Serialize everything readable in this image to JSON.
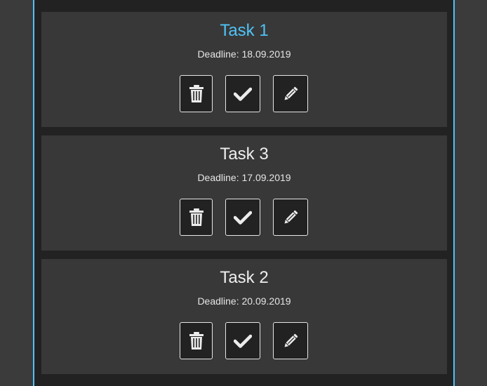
{
  "tasks": [
    {
      "title": "Task 1",
      "deadline": "Deadline: 18.09.2019",
      "highlighted": true,
      "actions": {
        "delete_icon": "trash-icon",
        "done_icon": "checkmark-icon",
        "edit_icon": "pencil-icon"
      }
    },
    {
      "title": "Task 3",
      "deadline": "Deadline: 17.09.2019",
      "highlighted": false,
      "actions": {
        "delete_icon": "trash-icon",
        "done_icon": "checkmark-icon",
        "edit_icon": "pencil-icon"
      }
    },
    {
      "title": "Task 2",
      "deadline": "Deadline: 20.09.2019",
      "highlighted": false,
      "actions": {
        "delete_icon": "trash-icon",
        "done_icon": "checkmark-icon",
        "edit_icon": "pencil-icon"
      }
    }
  ],
  "colors": {
    "accent": "#4fc3f7",
    "page_background": "#3b3b3b",
    "panel_background": "#222222",
    "card_background": "#383838",
    "text": "#eeeeee"
  }
}
